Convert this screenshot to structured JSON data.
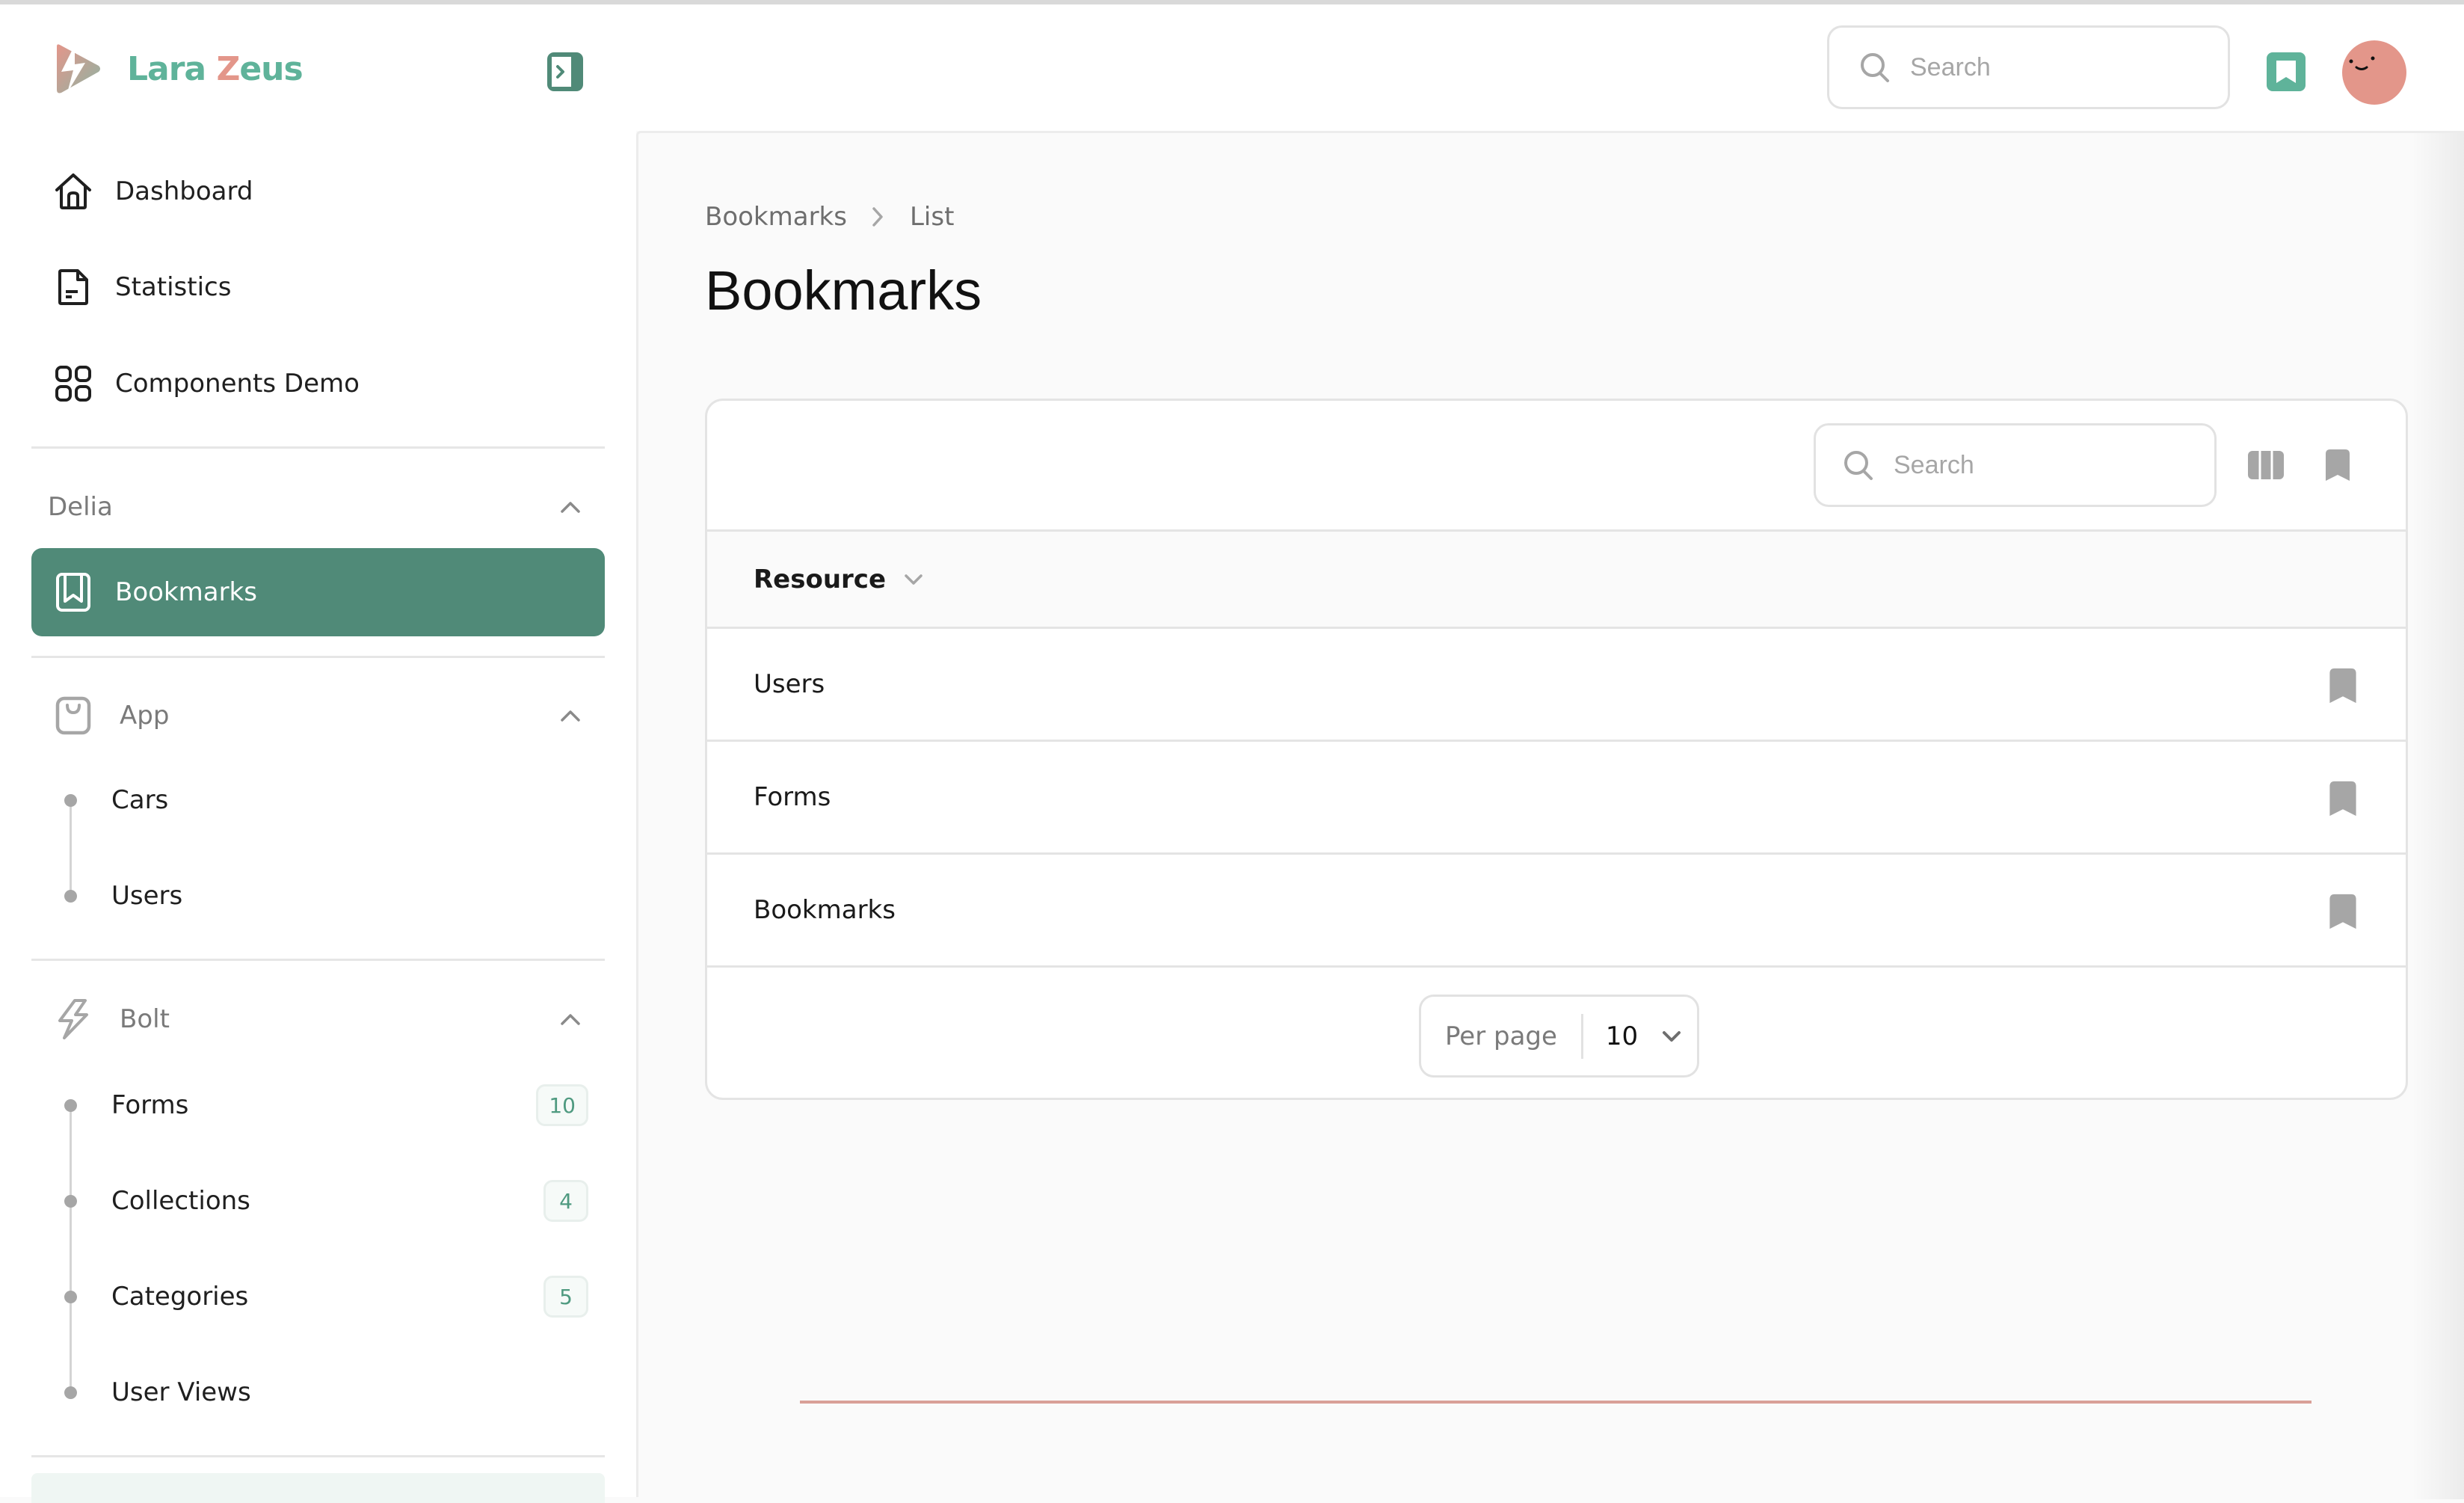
{
  "app": {
    "brand_first": "Lara ",
    "brand_z": "Z",
    "brand_rest": "eus",
    "colors": {
      "brand_teal": "#5fb39a",
      "brand_salmon": "#e3968a",
      "active_nav": "#508a78",
      "badge_text": "#4f9a80",
      "footer_link": "#e0614e"
    }
  },
  "topbar": {
    "search_placeholder": "Search",
    "search_value": "",
    "icons": {
      "collapse": "sidebar-expand-icon",
      "search": "search-icon",
      "bookmarks": "bookmark-icon",
      "avatar": "user-avatar"
    }
  },
  "sidebar": {
    "main_items": [
      {
        "label": "Dashboard",
        "icon": "home-icon"
      },
      {
        "label": "Statistics",
        "icon": "document-icon"
      },
      {
        "label": "Components Demo",
        "icon": "grid-icon"
      }
    ],
    "groups": [
      {
        "label": "Delia",
        "icon": null,
        "expanded": true,
        "items": [
          {
            "label": "Bookmarks",
            "icon": "bookmark-icon",
            "active": true
          }
        ]
      },
      {
        "label": "App",
        "icon": "shopping-bag-icon",
        "expanded": true,
        "items": [
          {
            "label": "Cars"
          },
          {
            "label": "Users"
          }
        ]
      },
      {
        "label": "Bolt",
        "icon": "bolt-icon",
        "expanded": true,
        "items": [
          {
            "label": "Forms",
            "badge": "10"
          },
          {
            "label": "Collections",
            "badge": "4"
          },
          {
            "label": "Categories",
            "badge": "5"
          },
          {
            "label": "User Views"
          }
        ]
      }
    ]
  },
  "main": {
    "breadcrumb": [
      "Bookmarks",
      "List"
    ],
    "title": "Bookmarks",
    "table": {
      "search_placeholder": "Search",
      "search_value": "",
      "columns": [
        {
          "label": "Resource",
          "sortable": true
        }
      ],
      "rows": [
        {
          "resource": "Users",
          "bookmarked": true
        },
        {
          "resource": "Forms",
          "bookmarked": true
        },
        {
          "resource": "Bookmarks",
          "bookmarked": true
        }
      ],
      "pagination": {
        "per_page_label": "Per page",
        "per_page_value": "10"
      }
    },
    "footer": {
      "text_clipped": true
    }
  }
}
